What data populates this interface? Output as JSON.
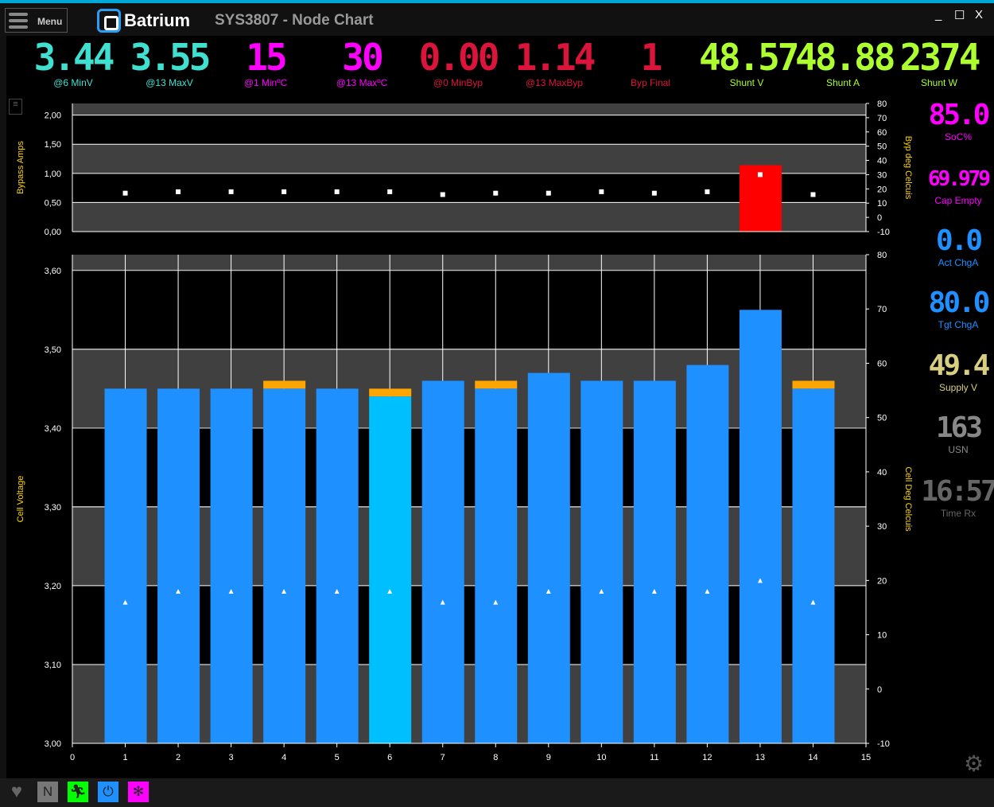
{
  "window": {
    "menu_label": "Menu",
    "brand": "Batrium",
    "title": "SYS3807 - Node Chart",
    "minimize": "_",
    "maximize": "☐",
    "close": "X"
  },
  "metrics": [
    {
      "value": "3.44",
      "label": "@6 MinV",
      "color": "#40e0d0"
    },
    {
      "value": "3.55",
      "label": "@13 MaxV",
      "color": "#40e0d0"
    },
    {
      "value": "15",
      "label": "@1 MinºC",
      "color": "#ff00ff"
    },
    {
      "value": "30",
      "label": "@13 MaxºC",
      "color": "#ff00ff"
    },
    {
      "value": "0.00",
      "label": "@0 MinByp",
      "color": "#dc143c"
    },
    {
      "value": "1.14",
      "label": "@13 MaxByp",
      "color": "#dc143c"
    },
    {
      "value": "1",
      "label": "Byp Final",
      "color": "#dc143c"
    },
    {
      "value": "48.57",
      "label": "Shunt V",
      "color": "#adff2f"
    },
    {
      "value": "48.88",
      "label": "Shunt A",
      "color": "#adff2f"
    },
    {
      "value": "2374",
      "label": "Shunt W",
      "color": "#adff2f"
    }
  ],
  "side_metrics": [
    {
      "value": "85.0",
      "label": "SoC%",
      "color": "#ff00ff"
    },
    {
      "value": "69.979",
      "label": "Cap Empty",
      "color": "#ff00ff"
    },
    {
      "value": "0.0",
      "label": "Act ChgA",
      "color": "#1e90ff"
    },
    {
      "value": "80.0",
      "label": "Tgt ChgA",
      "color": "#1e90ff"
    },
    {
      "value": "49.4",
      "label": "Supply V",
      "color": "#d8cf80"
    },
    {
      "value": "163",
      "label": "USN",
      "color": "#888888"
    },
    {
      "value": "16:57",
      "label": "Time Rx",
      "color": "#666666"
    }
  ],
  "chart_data": [
    {
      "type": "bar",
      "title": "Bypass",
      "ylabel": "Bypass Amps",
      "y2label": "Byp deg Celcuis",
      "ylim": [
        0,
        2.2
      ],
      "y2lim": [
        -10,
        80
      ],
      "yticks": [
        "0,00",
        "0,50",
        "1,00",
        "1,50",
        "2,00"
      ],
      "y2ticks": [
        "-10",
        "0",
        "10",
        "20",
        "30",
        "40",
        "50",
        "60",
        "70",
        "80"
      ],
      "x": [
        1,
        2,
        3,
        4,
        5,
        6,
        7,
        8,
        9,
        10,
        11,
        12,
        13,
        14
      ],
      "bypass_amps": [
        0,
        0,
        0,
        0,
        0,
        0,
        0,
        0,
        0,
        0,
        0,
        0,
        1.14,
        0
      ],
      "temps": [
        17,
        18,
        18,
        18,
        18,
        18,
        16,
        17,
        17,
        18,
        17,
        18,
        30,
        16
      ],
      "bar_color": "#ff0000"
    },
    {
      "type": "bar",
      "title": "Cell Voltage",
      "ylabel": "Cell Voltage",
      "y2label": "Cell Deg Celcuis",
      "ylim": [
        3.0,
        3.62
      ],
      "y2lim": [
        -10,
        80
      ],
      "yticks": [
        "3,00",
        "3,10",
        "3,20",
        "3,30",
        "3,40",
        "3,50",
        "3,60"
      ],
      "y2ticks": [
        "-10",
        "0",
        "10",
        "20",
        "30",
        "40",
        "50",
        "60",
        "70",
        "80"
      ],
      "xticks": [
        "0",
        "1",
        "2",
        "3",
        "4",
        "5",
        "6",
        "7",
        "8",
        "9",
        "10",
        "11",
        "12",
        "13",
        "14",
        "15"
      ],
      "x": [
        1,
        2,
        3,
        4,
        5,
        6,
        7,
        8,
        9,
        10,
        11,
        12,
        13,
        14
      ],
      "voltages": [
        3.45,
        3.45,
        3.45,
        3.45,
        3.45,
        3.44,
        3.46,
        3.45,
        3.47,
        3.46,
        3.46,
        3.48,
        3.55,
        3.45
      ],
      "upper": [
        3.45,
        3.45,
        3.45,
        3.46,
        3.45,
        3.45,
        3.46,
        3.46,
        3.47,
        3.46,
        3.46,
        3.48,
        3.55,
        3.46
      ],
      "temps": [
        16,
        18,
        18,
        18,
        18,
        18,
        16,
        16,
        18,
        18,
        18,
        18,
        20,
        16
      ],
      "colors": {
        "bar": "#1e90ff",
        "min_bar": "#00bfff",
        "upper": "#ffa500"
      }
    }
  ],
  "status_icons": [
    "heart-icon",
    "network-icon",
    "running-icon",
    "plug-icon",
    "fan-icon"
  ]
}
